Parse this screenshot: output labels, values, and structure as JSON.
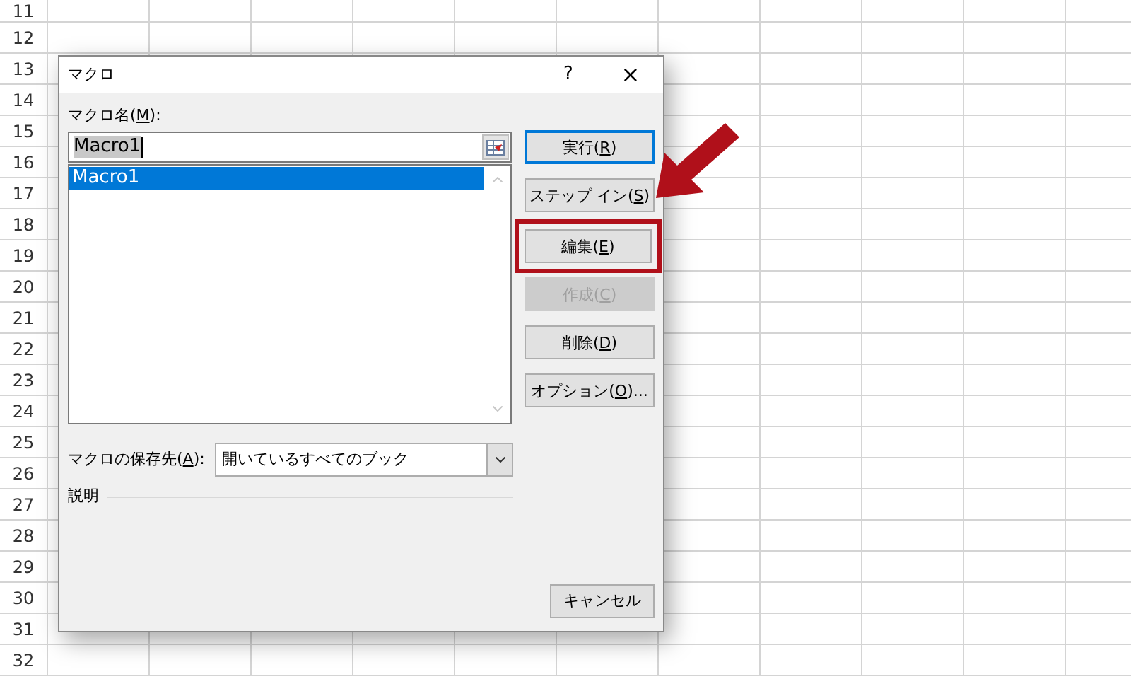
{
  "sheet": {
    "row_headers": [
      "11",
      "12",
      "13",
      "14",
      "15",
      "16",
      "17",
      "18",
      "19",
      "20",
      "21",
      "22",
      "23",
      "24",
      "25",
      "26",
      "27",
      "28",
      "29",
      "30",
      "31",
      "32"
    ]
  },
  "dialog": {
    "title": "マクロ",
    "help": "?",
    "close": "×",
    "name_label": [
      "マクロ名(",
      "M",
      "):"
    ],
    "name_field": {
      "value": "Macro1",
      "text_selected": true
    },
    "macro_list": [
      {
        "label": "Macro1",
        "selected": true
      }
    ],
    "buttons": [
      {
        "label": [
          "実行(",
          "R",
          ")"
        ],
        "default": true,
        "disabled": false,
        "highlighted": false
      },
      {
        "label": [
          "ステップ イン(",
          "S",
          ")"
        ],
        "default": false,
        "disabled": false,
        "highlighted": false
      },
      {
        "label": [
          "編集(",
          "E",
          ")"
        ],
        "default": false,
        "disabled": false,
        "highlighted": true
      },
      {
        "label": [
          "作成(",
          "C",
          ")"
        ],
        "default": false,
        "disabled": true,
        "highlighted": false
      },
      {
        "label": [
          "削除(",
          "D",
          ")"
        ],
        "default": false,
        "disabled": false,
        "highlighted": false
      },
      {
        "label": [
          "オプション(",
          "O",
          ")..."
        ],
        "default": false,
        "disabled": false,
        "highlighted": false
      }
    ],
    "location_label": [
      "マクロの保存先(",
      "A",
      "):"
    ],
    "location_select": {
      "value": "開いているすべてのブック"
    },
    "description_label": "説明",
    "cancel": "キャンセル"
  }
}
